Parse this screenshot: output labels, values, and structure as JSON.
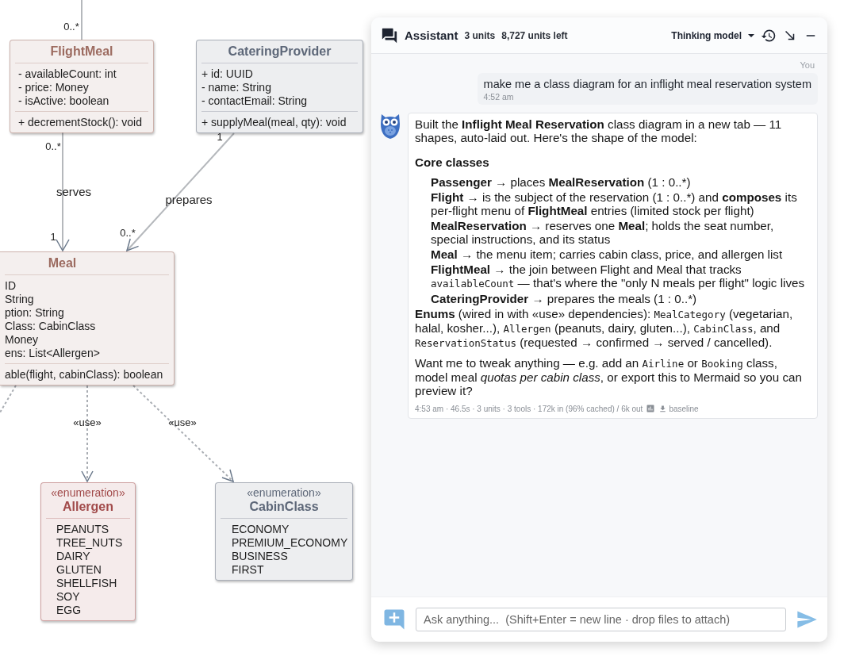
{
  "diagram": {
    "classes": [
      {
        "kind": "class",
        "name": "FlightMeal",
        "color": "#9c6b60",
        "attributes": [
          "- availableCount: int",
          "- price: Money",
          "- isActive: boolean"
        ],
        "methods": [
          "+ decrementStock(): void"
        ]
      },
      {
        "kind": "class",
        "name": "CateringProvider",
        "color": "#5d6778",
        "attributes": [
          "+ id: UUID",
          "- name: String",
          "- contactEmail: String"
        ],
        "methods": [
          "+ supplyMeal(meal, qty): void"
        ]
      },
      {
        "kind": "class",
        "name": "Meal",
        "color": "#9c6b60",
        "attributes": [
          "ID",
          "String",
          "ption: String",
          "Class: CabinClass",
          "Money",
          "ens: List<Allergen>"
        ],
        "methods": [
          "able(flight, cabinClass): boolean"
        ]
      },
      {
        "kind": "enumeration",
        "stereotype": "«enumeration»",
        "name": "Allergen",
        "color": "#a14a4a",
        "attributes": [
          "PEANUTS",
          "TREE_NUTS",
          "DAIRY",
          "GLUTEN",
          "SHELLFISH",
          "SOY",
          "EGG"
        ]
      },
      {
        "kind": "enumeration",
        "stereotype": "«enumeration»",
        "name": "CabinClass",
        "color": "#5d6778",
        "attributes": [
          "ECONOMY",
          "PREMIUM_ECONOMY",
          "BUSINESS",
          "FIRST"
        ]
      }
    ],
    "edges": [
      {
        "kind": "association",
        "target_multiplicity": "0..*"
      },
      {
        "kind": "association",
        "label": "serves",
        "source_multiplicity": "0..*",
        "target_multiplicity": "1"
      },
      {
        "kind": "association",
        "label": "prepares",
        "source_multiplicity": "1",
        "target_multiplicity": "0..*"
      },
      {
        "kind": "dependency",
        "label": "«use»"
      },
      {
        "kind": "dependency",
        "label": "«use»"
      },
      {
        "kind": "dependency"
      }
    ]
  },
  "assistant": {
    "title": "Assistant",
    "units": "3 units",
    "units_left": "8,727 units left",
    "model": "Thinking model",
    "messages": [
      {
        "kind": "user",
        "author": "You",
        "text": "make me a class diagram for an inflight meal reservation system",
        "time": "4:52 am"
      },
      {
        "kind": "assistant",
        "blocks": [
          {
            "kind": "para",
            "segments": [
              {
                "kind": "text",
                "text": "Built the **Inflight Meal Reservation** class diagram in a new tab — 11 shapes, auto-laid out. Here's the shape of the model:"
              }
            ]
          },
          {
            "kind": "heading",
            "segments": [
              {
                "kind": "text",
                "text": "Core classes"
              }
            ]
          },
          {
            "kind": "item",
            "segments": [
              {
                "kind": "text",
                "text": "**Passenger** → places **MealReservation** (1 : 0..*)"
              }
            ]
          },
          {
            "kind": "item",
            "segments": [
              {
                "kind": "text",
                "text": "**Flight** → is the subject of the reservation (1 : 0..*) and **composes** its per-flight menu of **FlightMeal** entries (limited stock per flight)"
              }
            ]
          },
          {
            "kind": "item",
            "segments": [
              {
                "kind": "text",
                "text": "**MealReservation** → reserves one **Meal**; holds the seat number, special instructions, and its status"
              }
            ]
          },
          {
            "kind": "item",
            "segments": [
              {
                "kind": "text",
                "text": "**Meal** → the menu item; carries cabin class, price, and allergen list"
              }
            ]
          },
          {
            "kind": "item",
            "segments": [
              {
                "kind": "text",
                "text": "**FlightMeal** → the join between Flight and Meal that tracks "
              },
              {
                "kind": "code",
                "text": "availableCount"
              },
              {
                "kind": "text",
                "text": " — that's where the \"only N meals per flight\" logic lives"
              }
            ]
          },
          {
            "kind": "item",
            "segments": [
              {
                "kind": "text",
                "text": "**CateringProvider** → prepares the meals (1 : 0..*)"
              }
            ]
          },
          {
            "kind": "para",
            "segments": [
              {
                "kind": "text",
                "text": "**Enums** (wired in with «use» dependencies): "
              },
              {
                "kind": "code",
                "text": "MealCategory"
              },
              {
                "kind": "text",
                "text": " (vegetarian, halal, kosher...), "
              },
              {
                "kind": "code",
                "text": "Allergen"
              },
              {
                "kind": "text",
                "text": " (peanuts, dairy, gluten...), "
              },
              {
                "kind": "code",
                "text": "CabinClass"
              },
              {
                "kind": "text",
                "text": ", and "
              },
              {
                "kind": "code",
                "text": "ReservationStatus"
              },
              {
                "kind": "text",
                "text": " (requested → confirmed → served / cancelled)."
              }
            ]
          },
          {
            "kind": "para",
            "segments": [
              {
                "kind": "text",
                "text": "Want me to tweak anything — e.g. add an "
              },
              {
                "kind": "code",
                "text": "Airline"
              },
              {
                "kind": "text",
                "text": " or "
              },
              {
                "kind": "code",
                "text": "Booking"
              },
              {
                "kind": "text",
                "text": " class, model meal *quotas per cabin class*, or export this to Mermaid so you can preview it?"
              }
            ]
          }
        ],
        "meta": "4:53 am · 46.5s · 3 units · 3 tools · 172k in (96% cached) / 6k out",
        "download_label": "baseline"
      }
    ],
    "input": {
      "placeholder": "Ask anything...  (Shift+Enter = new line · drop files to attach)"
    }
  }
}
